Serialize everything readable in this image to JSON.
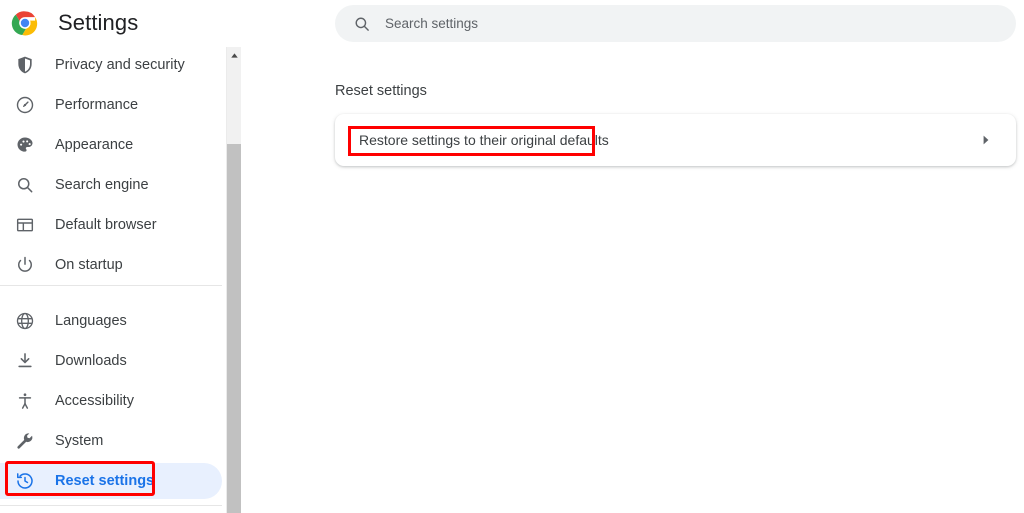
{
  "brand": {
    "logo_icon": "chrome-logo-icon",
    "title": "Settings",
    "colors": {
      "red": "#ea4335",
      "yellow": "#fbbc05",
      "green": "#34a853",
      "blue": "#4285f4"
    }
  },
  "sidebar": {
    "groups": [
      {
        "items": [
          {
            "label": "Privacy and security",
            "icon": "shield-icon",
            "selected": false
          },
          {
            "label": "Performance",
            "icon": "speedometer-icon",
            "selected": false
          },
          {
            "label": "Appearance",
            "icon": "palette-icon",
            "selected": false
          },
          {
            "label": "Search engine",
            "icon": "magnifier-icon",
            "selected": false
          },
          {
            "label": "Default browser",
            "icon": "browser-window-icon",
            "selected": false
          },
          {
            "label": "On startup",
            "icon": "power-icon",
            "selected": false
          }
        ]
      },
      {
        "items": [
          {
            "label": "Languages",
            "icon": "globe-icon",
            "selected": false
          },
          {
            "label": "Downloads",
            "icon": "download-icon",
            "selected": false
          },
          {
            "label": "Accessibility",
            "icon": "person-icon",
            "selected": false
          },
          {
            "label": "System",
            "icon": "wrench-icon",
            "selected": false
          },
          {
            "label": "Reset settings",
            "icon": "history-restore-icon",
            "selected": true
          }
        ]
      }
    ],
    "selected_color": "#1a73e8",
    "selected_pill_color": "#e8f0fe"
  },
  "scrollbar": {
    "up_arrow_icon": "caret-up-icon",
    "thumb_color": "#c1c1c1",
    "track_color": "#f1f1f1"
  },
  "search": {
    "icon": "search-icon",
    "placeholder": "Search settings",
    "value": ""
  },
  "main": {
    "section_title": "Reset settings",
    "rows": [
      {
        "label": "Restore settings to their original defaults",
        "chevron_icon": "chevron-right-icon"
      }
    ]
  },
  "annotations": {
    "color": "#ff0000",
    "boxes": [
      {
        "name": "restore-defaults-highlight",
        "target": "Restore settings to their original defaults"
      },
      {
        "name": "reset-settings-nav-highlight",
        "target": "Reset settings"
      }
    ]
  }
}
